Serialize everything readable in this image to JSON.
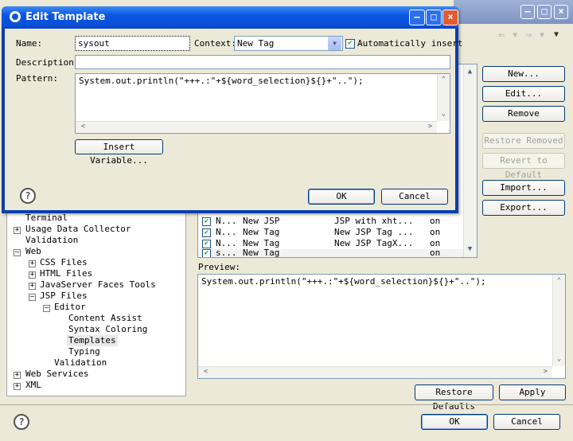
{
  "back_window": {
    "buttons": {
      "new": "New...",
      "edit": "Edit...",
      "remove": "Remove",
      "restore_removed": "Restore Removed",
      "revert_to_default": "Revert to Default",
      "import": "Import...",
      "export": "Export...",
      "restore_defaults": "Restore Defaults",
      "apply": "Apply",
      "ok": "OK",
      "cancel": "Cancel"
    },
    "preview_label": "Preview:",
    "preview_text": "System.out.println(\"+++.:\"+${word_selection}${}+\"..\");",
    "tree": [
      {
        "label": "Terminal"
      },
      {
        "label": "Usage Data Collector"
      },
      {
        "label": "Validation"
      },
      {
        "label": "Web"
      },
      {
        "label": "CSS Files"
      },
      {
        "label": "HTML Files"
      },
      {
        "label": "JavaServer Faces Tools"
      },
      {
        "label": "JSP Files"
      },
      {
        "label": "Editor"
      },
      {
        "label": "Content Assist"
      },
      {
        "label": "Syntax Coloring"
      },
      {
        "label": "Templates"
      },
      {
        "label": "Typing"
      },
      {
        "label": "Validation"
      },
      {
        "label": "Web Services"
      },
      {
        "label": "XML"
      }
    ],
    "templates_rows": [
      {
        "name": "N...",
        "context": "New JSP",
        "description": "JSP with xht...",
        "auto": "on"
      },
      {
        "name": "N...",
        "context": "New Tag",
        "description": "New JSP Tag ...",
        "auto": "on"
      },
      {
        "name": "N...",
        "context": "New Tag",
        "description": "New JSP TagX...",
        "auto": "on"
      },
      {
        "name": "s...",
        "context": "New Tag",
        "description": "",
        "auto": "on"
      }
    ]
  },
  "dialog": {
    "title": "Edit Template",
    "name_label": "Name:",
    "name_value": "sysout",
    "context_label": "Context:",
    "context_value": "New Tag",
    "auto_insert_label": "Automatically insert",
    "description_label": "Description:",
    "description_value": "",
    "pattern_label": "Pattern:",
    "pattern_value": "System.out.println(\"+++.:\"+${word_selection}${}+\"..\");",
    "insert_variable": "Insert Variable...",
    "ok": "OK",
    "cancel": "Cancel"
  },
  "colors": {
    "titlebar": "#0a54e3",
    "dialog_border": "#0b3fa8",
    "window_bg": "#ece9d8"
  }
}
